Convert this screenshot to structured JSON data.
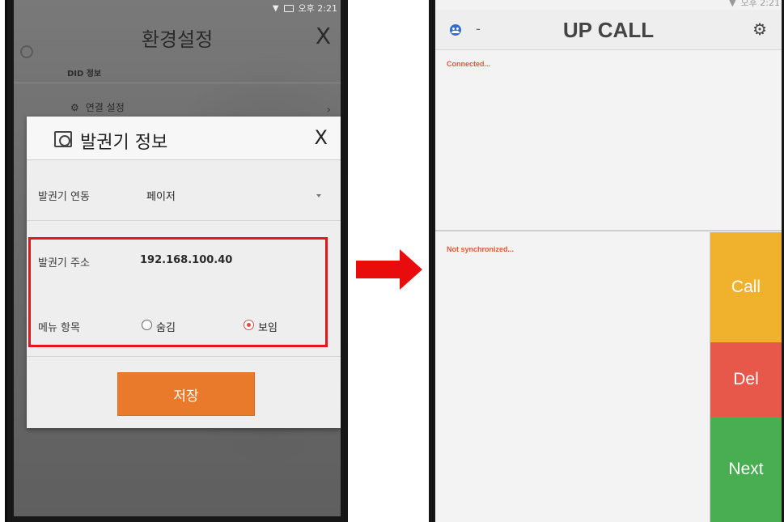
{
  "left": {
    "status": {
      "time": "오후 2:21"
    },
    "settings": {
      "title": "환경설정",
      "close": "X",
      "did_label": "DID 정보",
      "conn_label": "연결 설정",
      "chevron": "›"
    },
    "dialog": {
      "title": "발권기 정보",
      "close": "X",
      "link_label": "발권기 연동",
      "link_value": "페이저",
      "address_label": "발권기 주소",
      "address_value": "192.168.100.40",
      "menu_label": "메뉴 항목",
      "option_hide": "숨김",
      "option_show": "보임",
      "selected": "보임",
      "save_label": "저장"
    }
  },
  "right": {
    "status": {
      "time": "오후 2:21"
    },
    "title": "UP CALL",
    "dash": "-",
    "connected": "Connected...",
    "sync": "Not synchronized...",
    "buttons": {
      "call": "Call",
      "del": "Del",
      "next": "Next"
    }
  },
  "colors": {
    "highlight": "#e2161c",
    "save": "#ea7a2b",
    "call": "#f0b12d",
    "del": "#e8584a",
    "next": "#49ad52",
    "status_text": "#e2593f"
  }
}
